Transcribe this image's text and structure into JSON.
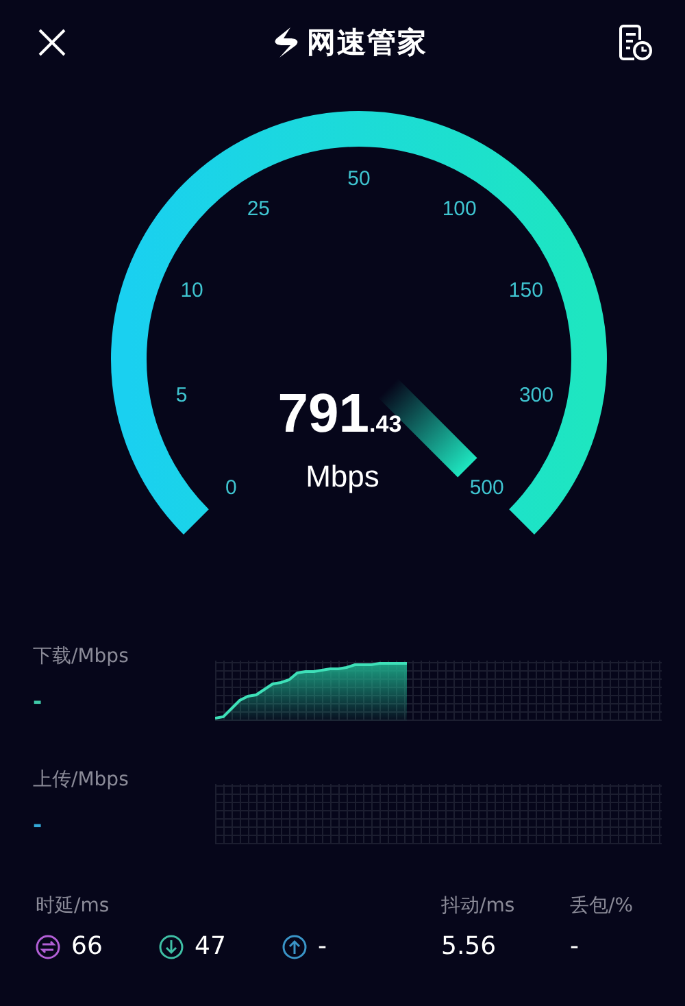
{
  "header": {
    "title": "网速管家"
  },
  "gauge": {
    "scale_labels": [
      "0",
      "5",
      "10",
      "25",
      "50",
      "100",
      "150",
      "300",
      "500"
    ],
    "speed_integer": "791",
    "speed_decimal": ".43",
    "unit": "Mbps"
  },
  "graphs": [
    {
      "kind": "download",
      "label": "下载/Mbps",
      "value": "-"
    },
    {
      "kind": "upload",
      "label": "上传/Mbps",
      "value": "-"
    }
  ],
  "stats": {
    "latency_label": "时延/ms",
    "latency": [
      {
        "kind": "total",
        "value": "66"
      },
      {
        "kind": "down",
        "value": "47"
      },
      {
        "kind": "up",
        "value": "-"
      }
    ],
    "jitter_label": "抖动/ms",
    "jitter": "5.56",
    "loss_label": "丢包/%",
    "loss": "-"
  }
}
